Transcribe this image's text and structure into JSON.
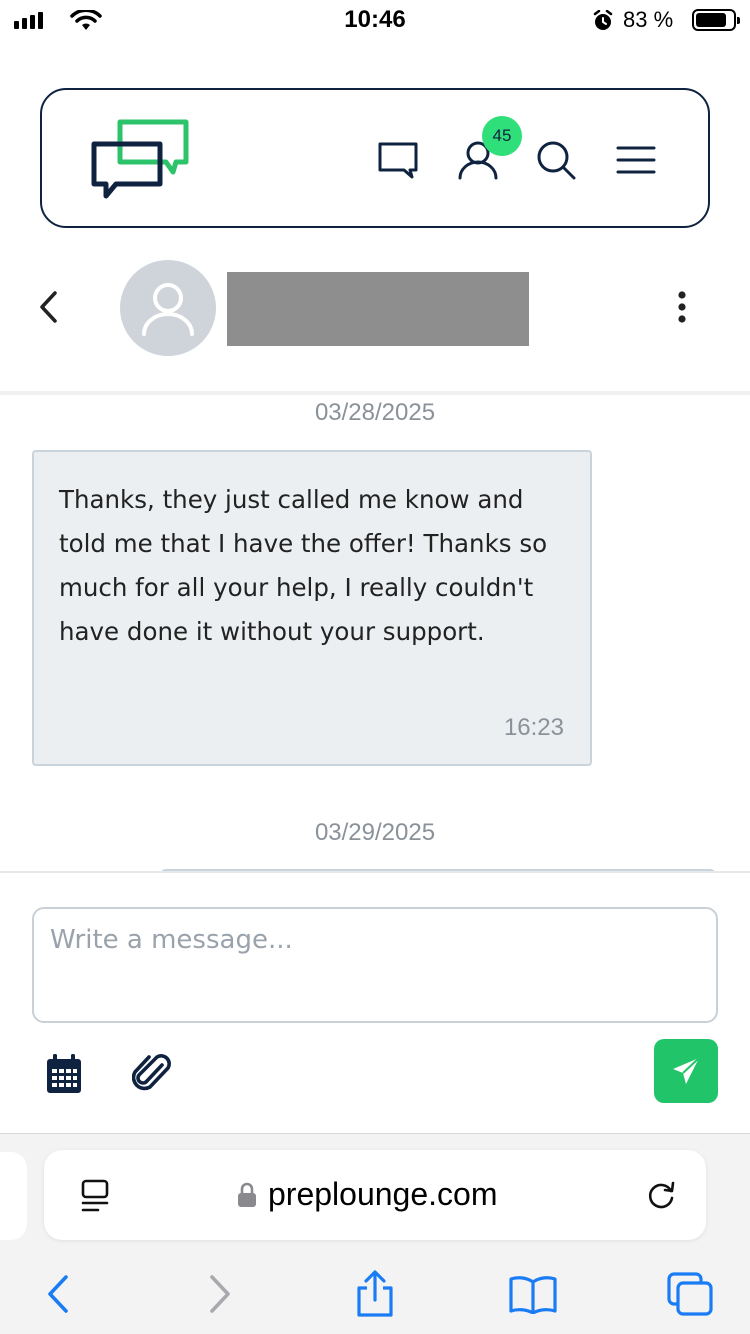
{
  "status_bar": {
    "time": "10:46",
    "battery_percent": "83 %",
    "battery_level": 0.83,
    "icons": [
      "signal-icon",
      "wifi-icon",
      "alarm-icon",
      "battery-icon"
    ]
  },
  "header": {
    "logo": "preplounge-logo",
    "notification_count": "45",
    "icons": [
      "messages-icon",
      "profile-icon",
      "search-icon",
      "menu-icon"
    ],
    "colors": {
      "navy": "#0f2340",
      "green": "#2fe07a"
    }
  },
  "conversation": {
    "contact_name": "",
    "icons": [
      "back-chevron-icon",
      "avatar-placeholder-icon",
      "more-vertical-icon"
    ]
  },
  "messages": [
    {
      "date": "03/28/2025",
      "text": "Thanks, they just called me know and told me that I have the offer! Thanks so much for all your help, I really couldn't have done it without your support.",
      "time": "16:23"
    },
    {
      "date": "03/29/2025"
    }
  ],
  "composer": {
    "placeholder": "Write a message...",
    "value": "",
    "icons": [
      "calendar-icon",
      "paperclip-icon",
      "send-icon"
    ],
    "send_color": "#22c46a"
  },
  "browser": {
    "url": "preplounge.com",
    "icons": [
      "reader-icon",
      "lock-icon",
      "reload-icon",
      "back-icon",
      "forward-icon",
      "share-icon",
      "bookmarks-icon",
      "tabs-icon"
    ],
    "accent": "#1a7cf5"
  }
}
